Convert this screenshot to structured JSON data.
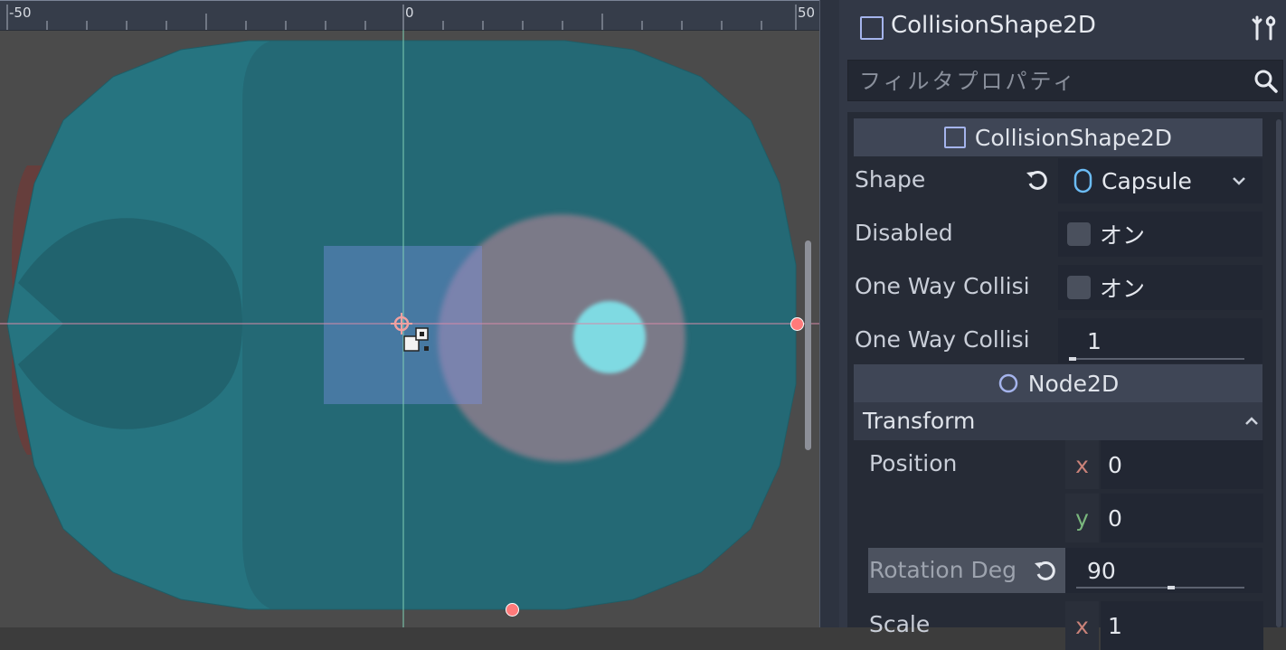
{
  "viewport": {
    "ruler": {
      "labels": [
        "-50",
        "0",
        "50"
      ]
    }
  },
  "inspector": {
    "header": {
      "node_name": "CollisionShape2D",
      "tools_icon": "tools-icon"
    },
    "filter": {
      "placeholder": "フィルタプロパティ",
      "icon": "search-icon"
    },
    "sections": {
      "collision_shape": {
        "title": "CollisionShape2D",
        "props": {
          "shape": {
            "label": "Shape",
            "value": "Capsule"
          },
          "disabled": {
            "label": "Disabled",
            "value": "オン",
            "checked": false
          },
          "one_way": {
            "label": "One Way Collisi",
            "value": "オン",
            "checked": false
          },
          "one_way_margin": {
            "label": "One Way Collisi",
            "value": "1"
          }
        }
      },
      "node2d": {
        "title": "Node2D",
        "transform": {
          "title": "Transform",
          "position": {
            "label": "Position",
            "x_label": "x",
            "x": "0",
            "y_label": "y",
            "y": "0"
          },
          "rotation": {
            "label": "Rotation Deg",
            "value": "90"
          },
          "scale": {
            "label": "Scale",
            "x_label": "x",
            "x": "1"
          }
        }
      }
    }
  },
  "colors": {
    "capsule_fill": "#267480",
    "accent_icon": "#a5b4ec",
    "handle": "#ff7a7a",
    "axis_x": "#c98279",
    "axis_y": "#7ab77d"
  }
}
